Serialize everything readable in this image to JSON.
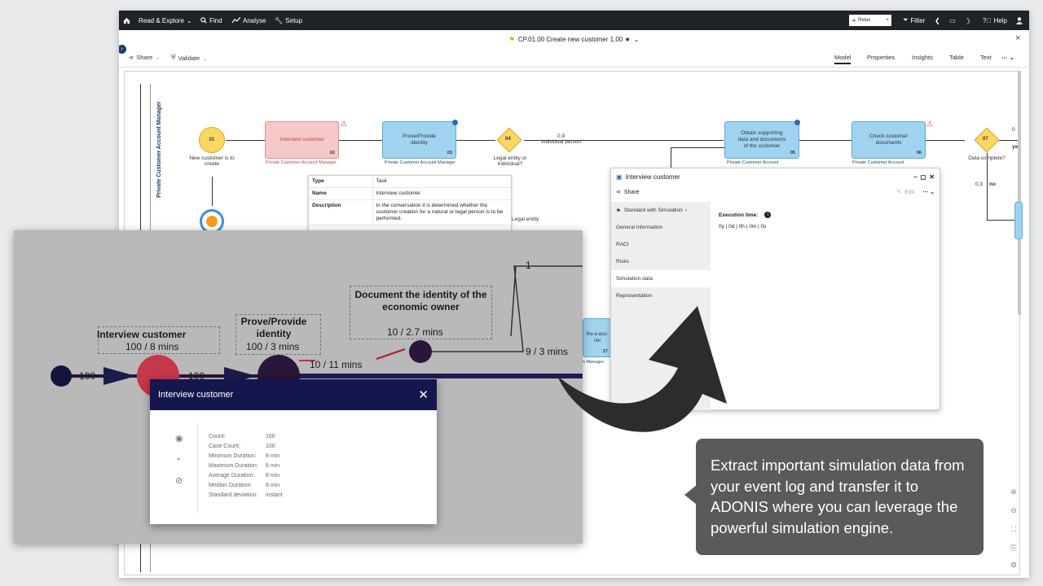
{
  "topbar": {
    "items": [
      "Read & Explore",
      "Find",
      "Analyse",
      "Setup"
    ],
    "relax_label": "Relax",
    "filter_label": "Filter",
    "help_label": "Help"
  },
  "titlebar": {
    "title": "CP.01.00 Create new customer 1.00 ★"
  },
  "toolbar": {
    "share_label": "Share",
    "validate_label": "Validate",
    "tabs": [
      "Model",
      "Properties",
      "Insights",
      "Table",
      "Text"
    ]
  },
  "diagram": {
    "lane_label": "Private Customer Account Manager",
    "start_event": {
      "num": "01",
      "label": "New customer is to create"
    },
    "task_interview": {
      "label": "Interview customer",
      "num": "02",
      "role": "Private Customer Account Manager"
    },
    "task_prove": {
      "label": "Prove/Provide identity",
      "num": "03",
      "role": "Private Customer Account Manager"
    },
    "gateway_04": {
      "num": "04",
      "label": "Legal entity or individual?"
    },
    "edge_09": "0.9",
    "edge_individual": "Individual person",
    "edge_legal": "Legal entity",
    "task_obtain": {
      "label": "Obtain supporting data and documents of the customer",
      "num": "05",
      "role": "Private Customer Account"
    },
    "task_check": {
      "label": "Check customer documents",
      "num": "06",
      "role": "Private Customer Account"
    },
    "gateway_07": {
      "num": "07",
      "label": "Data complete?"
    },
    "edge_03": "0.3",
    "edge_no": "no",
    "edge_right_value": "0",
    "edge_yes": "ye",
    "partial_task_num": "17",
    "partial_task_text": "the e-eco-\nner",
    "partial_task_role": "n Manager"
  },
  "tooltip": {
    "rows": [
      {
        "k": "Type",
        "v": "Task"
      },
      {
        "k": "Name",
        "v": "Interview customer"
      },
      {
        "k": "Description",
        "v": "In the conversation it is determined whether the customer creation for a natural or legal person is to be performed."
      }
    ]
  },
  "panel": {
    "title": "Interview customer",
    "share_label": "Share",
    "edit_label": "Edit",
    "sidebar": [
      "Standard with Simulation",
      "General information",
      "RACI",
      "Risks",
      "Simulation data",
      "Representation"
    ],
    "execution_time_label": "Execution time:",
    "execution_time_value": "0y | 0d | 0h | 0m | 0s"
  },
  "zoom": {
    "edge_100_a": "100",
    "edge_100_b": "100",
    "interview_label": "Interview customer",
    "interview_sub": "100 / 8 mins",
    "prove_label": "Prove/Provide identity",
    "prove_sub": "100 / 3 mins",
    "edge_10_11": "10 / 11 mins",
    "doc_label": "Document the identity of the economic owner",
    "doc_sub": "10 / 2.7 mins",
    "edge_9_3": "9 / 3 mins",
    "edge_1": "1"
  },
  "modal": {
    "title": "Interview customer",
    "stats": [
      {
        "k": "Count:",
        "v": "100"
      },
      {
        "k": "Case Count:",
        "v": "100"
      },
      {
        "k": "Minimum Duration:",
        "v": "8 min"
      },
      {
        "k": "Maximum Duration:",
        "v": "8 min"
      },
      {
        "k": "Average Duration:",
        "v": "8 min"
      },
      {
        "k": "Median Duration:",
        "v": "8 min"
      },
      {
        "k": "Standard deviation:",
        "v": "instant"
      }
    ]
  },
  "callout": {
    "text": "Extract important simulation data from your event log and transfer it to ADONIS where you can leverage the powerful simulation engine."
  },
  "colors": {
    "topbar": "#1f2327",
    "task_blue": "#9fd3f0",
    "task_red": "#f6c8c8",
    "gateway": "#fdd764",
    "modal_header": "#16164f",
    "process_node": "#2a1638",
    "highlight_node": "#c7374a",
    "callout": "#5a5a5a"
  }
}
